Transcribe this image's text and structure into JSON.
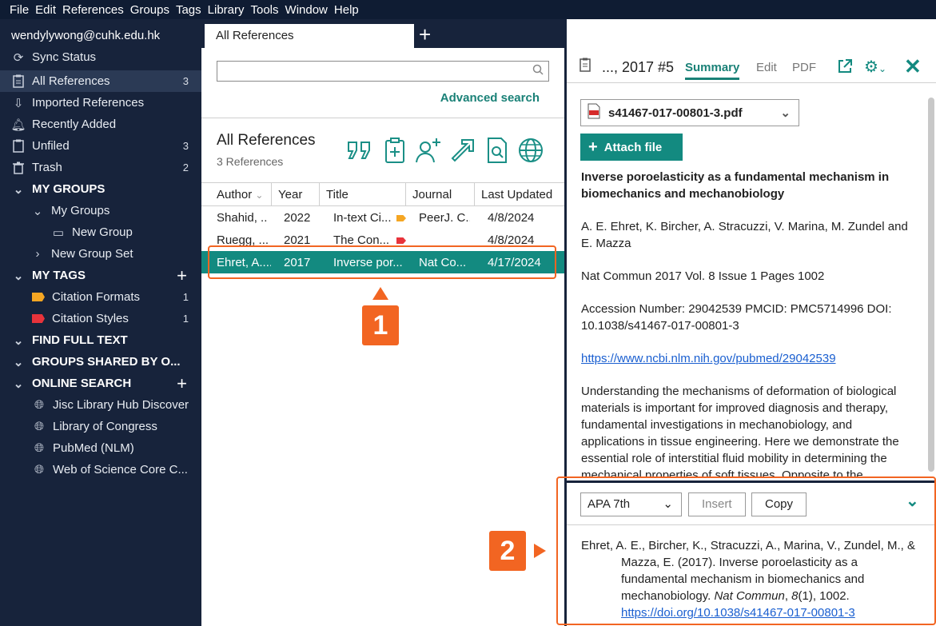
{
  "menu": [
    "File",
    "Edit",
    "References",
    "Groups",
    "Tags",
    "Library",
    "Tools",
    "Window",
    "Help"
  ],
  "sidebar": {
    "account": "wendylywong@cuhk.edu.hk",
    "sync": "Sync Status",
    "all_refs": {
      "label": "All References",
      "count": "3"
    },
    "imported": "Imported References",
    "recent": "Recently Added",
    "unfiled": {
      "label": "Unfiled",
      "count": "3"
    },
    "trash": {
      "label": "Trash",
      "count": "2"
    },
    "my_groups": "MY GROUPS",
    "my_groups_sub": "My Groups",
    "new_group": "New Group",
    "new_group_set": "New Group Set",
    "my_tags": "MY TAGS",
    "tag1": {
      "label": "Citation Formats",
      "count": "1",
      "color": "#f5a623"
    },
    "tag2": {
      "label": "Citation Styles",
      "count": "1",
      "color": "#e8333b"
    },
    "find_full_text": "FIND FULL TEXT",
    "groups_shared": "GROUPS SHARED BY O...",
    "online_search": "ONLINE SEARCH",
    "online": [
      "Jisc Library Hub Discover",
      "Library of Congress",
      "PubMed (NLM)",
      "Web of Science Core C..."
    ]
  },
  "middle": {
    "tab": "All References",
    "search_placeholder": "",
    "advanced": "Advanced search",
    "title": "All References",
    "count": "3 References",
    "columns": [
      "Author",
      "Year",
      "Title",
      "Journal",
      "Last Updated"
    ],
    "rows": [
      {
        "author": "Shahid, ...",
        "year": "2022",
        "title": "In-text Ci...",
        "journal": "PeerJ. C...",
        "updated": "4/8/2024",
        "tag": "#f5a623"
      },
      {
        "author": "Ruegg, ...",
        "year": "2021",
        "title": "The Con...",
        "journal": "",
        "updated": "4/8/2024",
        "tag": "#e8333b"
      },
      {
        "author": "Ehret, A....",
        "year": "2017",
        "title": "Inverse por...",
        "journal": "Nat Co...",
        "updated": "4/17/2024",
        "tag": ""
      }
    ]
  },
  "callouts": {
    "one": "1",
    "two": "2"
  },
  "right": {
    "ref_name": "..., 2017 #5",
    "tabs": [
      "Summary",
      "Edit",
      "PDF"
    ],
    "pdf": "s41467-017-00801-3.pdf",
    "attach": "Attach file",
    "title": "Inverse poroelasticity as a fundamental mechanism in biomechanics and mechanobiology",
    "authors": "A. E. Ehret, K. Bircher, A. Stracuzzi, V. Marina, M. Zundel and E. Mazza",
    "source": "Nat Commun 2017 Vol. 8 Issue 1 Pages 1002",
    "ids": "Accession Number: 29042539 PMCID: PMC5714996 DOI: 10.1038/s41467-017-00801-3",
    "url": "https://www.ncbi.nlm.nih.gov/pubmed/29042539",
    "abstract": "Understanding the mechanisms of deformation of biological materials is important for improved diagnosis and therapy, fundamental investigations in mechanobiology, and applications in tissue engineering. Here we demonstrate the essential role of interstitial fluid mobility in determining the mechanical properties of soft tissues. Opposite to the",
    "style": "APA 7th",
    "insert": "Insert",
    "copy": "Copy",
    "citation_main": "Ehret, A. E., Bircher, K., Stracuzzi, A., Marina, V., Zundel, M., & Mazza, E. (2017). Inverse poroelasticity as a fundamental mechanism in biomechanics and mechanobiology.",
    "citation_journal": "Nat Commun",
    "citation_vol": "8",
    "citation_rest": "(1), 1002.",
    "citation_doi": "https://doi.org/10.1038/s41467-017-00801-3"
  }
}
